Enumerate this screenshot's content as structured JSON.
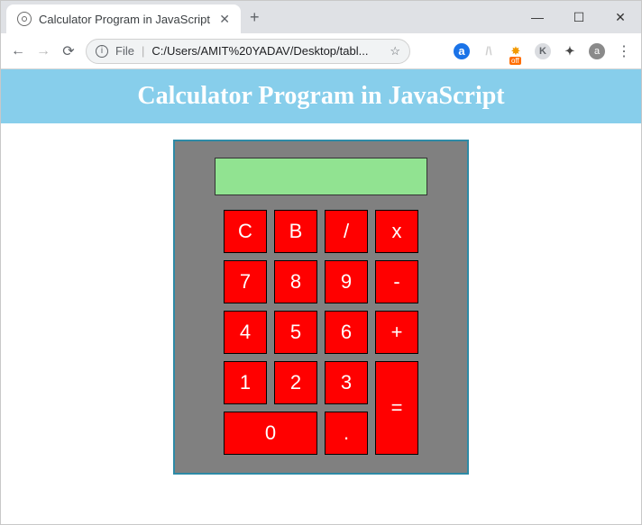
{
  "window": {
    "tab_title": "Calculator Program in JavaScript",
    "new_tab": "+",
    "minimize": "—",
    "maximize": "☐",
    "close": "✕"
  },
  "toolbar": {
    "back": "←",
    "forward": "→",
    "reload": "⟳",
    "url_prefix": "File",
    "url": "C:/Users/AMIT%20YADAV/Desktop/tabl...",
    "star": "☆",
    "ext_a": "a",
    "ext_arc": "/\\",
    "ext_fire": "✸",
    "ext_fire_badge": "off",
    "ext_k": "K",
    "ext_puzzle": "✦",
    "ext_avatar": "a",
    "ext_menu": "⋮"
  },
  "page": {
    "heading": "Calculator Program in JavaScript"
  },
  "calc": {
    "display": "",
    "row1": {
      "c": "C",
      "b": "B",
      "div": "/",
      "mul": "x"
    },
    "row2": {
      "k7": "7",
      "k8": "8",
      "k9": "9",
      "sub": "-"
    },
    "row3": {
      "k4": "4",
      "k5": "5",
      "k6": "6",
      "add": "+"
    },
    "row4": {
      "k1": "1",
      "k2": "2",
      "k3": "3"
    },
    "row5": {
      "k0": "0",
      "dot": "."
    },
    "eq": "="
  }
}
